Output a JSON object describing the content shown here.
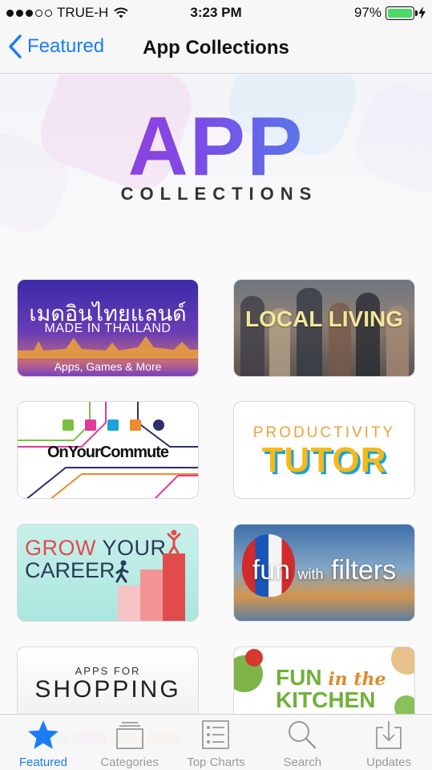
{
  "status_bar": {
    "carrier": "TRUE-H",
    "time": "3:23 PM",
    "battery_percent": "97%",
    "signal_bars_filled": 3,
    "battery_level": 0.97
  },
  "nav": {
    "back_label": "Featured",
    "title": "App Collections"
  },
  "hero": {
    "title": "APP",
    "subtitle": "COLLECTIONS"
  },
  "collections": {
    "made_in_thailand": {
      "thai_name": "เมดอินไทยแลนด์",
      "english_name": "MADE IN THAILAND",
      "footer": "Apps, Games & More"
    },
    "local_living": {
      "title": "LOCAL LIVING"
    },
    "on_your_commute": {
      "title": "OnYourCommute"
    },
    "productivity_tutor": {
      "line1": "PRODUCTIVITY",
      "line2": "TUTOR"
    },
    "grow_your_career": {
      "word1": "GROW",
      "word2": "YOUR",
      "word3": "CAREER"
    },
    "fun_with_filters": {
      "word1": "fun",
      "word2": "with",
      "word3": "filters"
    },
    "apps_for_shopping": {
      "line1": "APPS FOR",
      "line2": "SHOPPING"
    },
    "fun_in_the_kitchen": {
      "word1": "FUN",
      "word2": "in the",
      "line2": "KITCHEN"
    }
  },
  "tab_bar": {
    "tabs": [
      {
        "label": "Featured",
        "icon": "star-icon",
        "active": true
      },
      {
        "label": "Categories",
        "icon": "categories-icon",
        "active": false
      },
      {
        "label": "Top Charts",
        "icon": "list-icon",
        "active": false
      },
      {
        "label": "Search",
        "icon": "search-icon",
        "active": false
      },
      {
        "label": "Updates",
        "icon": "download-icon",
        "active": false
      }
    ]
  },
  "colors": {
    "ios_blue": "#1b7cf5",
    "tab_inactive": "#9a9a9e",
    "battery_green": "#4cd964"
  }
}
